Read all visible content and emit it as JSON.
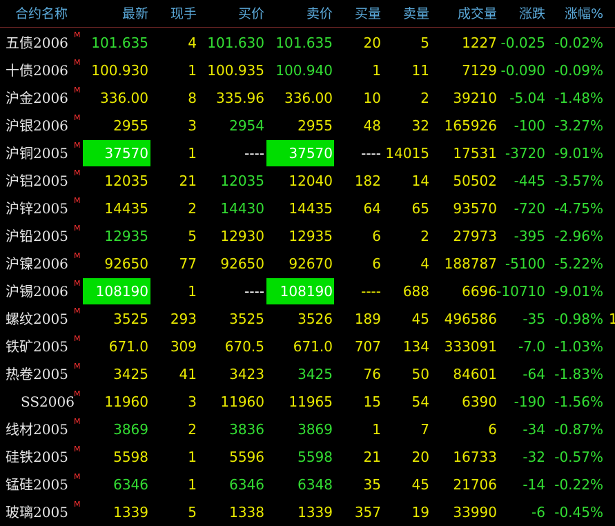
{
  "headers": [
    "合约名称",
    "最新",
    "现手",
    "买价",
    "卖价",
    "买量",
    "卖量",
    "成交量",
    "涨跌",
    "涨幅%"
  ],
  "marker": "M",
  "colors": {
    "header": "#5aa8d8",
    "yellow": "#e8e800",
    "green": "#33dd33",
    "highlight": "#00dd00",
    "marker": "#ff3333"
  },
  "rows": [
    {
      "name": "五债2006",
      "last": "101.635",
      "vol": "4",
      "bid": "101.630",
      "ask": "101.635",
      "bq": "20",
      "aq": "5",
      "tot": "1227",
      "chg": "-0.025",
      "pct": "-0.02%"
    },
    {
      "name": "十债2006",
      "last": "100.930",
      "vol": "1",
      "bid": "100.935",
      "ask": "100.940",
      "bq": "1",
      "aq": "11",
      "tot": "7129",
      "chg": "-0.090",
      "pct": "-0.09%"
    },
    {
      "name": "沪金2006",
      "last": "336.00",
      "vol": "8",
      "bid": "335.96",
      "ask": "336.00",
      "bq": "10",
      "aq": "2",
      "tot": "39210",
      "chg": "-5.04",
      "pct": "-1.48%"
    },
    {
      "name": "沪银2006",
      "last": "2955",
      "vol": "3",
      "bid": "2954",
      "ask": "2955",
      "bq": "48",
      "aq": "32",
      "tot": "165926",
      "chg": "-100",
      "pct": "-3.27%"
    },
    {
      "name": "沪铜2005",
      "last": "37570",
      "vol": "1",
      "bid": "----",
      "ask": "37570",
      "bq": "----",
      "aq": "14015",
      "tot": "17531",
      "chg": "-3720",
      "pct": "-9.01%"
    },
    {
      "name": "沪铝2005",
      "last": "12035",
      "vol": "21",
      "bid": "12035",
      "ask": "12040",
      "bq": "182",
      "aq": "14",
      "tot": "50502",
      "chg": "-445",
      "pct": "-3.57%"
    },
    {
      "name": "沪锌2005",
      "last": "14435",
      "vol": "2",
      "bid": "14430",
      "ask": "14435",
      "bq": "64",
      "aq": "65",
      "tot": "93570",
      "chg": "-720",
      "pct": "-4.75%"
    },
    {
      "name": "沪铅2005",
      "last": "12935",
      "vol": "5",
      "bid": "12930",
      "ask": "12935",
      "bq": "6",
      "aq": "2",
      "tot": "27973",
      "chg": "-395",
      "pct": "-2.96%"
    },
    {
      "name": "沪镍2006",
      "last": "92650",
      "vol": "77",
      "bid": "92650",
      "ask": "92670",
      "bq": "6",
      "aq": "4",
      "tot": "188787",
      "chg": "-5100",
      "pct": "-5.22%"
    },
    {
      "name": "沪锡2006",
      "last": "108190",
      "vol": "1",
      "bid": "----",
      "ask": "108190",
      "bq": "----",
      "aq": "688",
      "tot": "6696",
      "chg": "-10710",
      "pct": "-9.01%"
    },
    {
      "name": "螺纹2005",
      "last": "3525",
      "vol": "293",
      "bid": "3525",
      "ask": "3526",
      "bq": "189",
      "aq": "45",
      "tot": "496586",
      "chg": "-35",
      "pct": "-0.98%",
      "extra": "1"
    },
    {
      "name": "铁矿2005",
      "last": "671.0",
      "vol": "309",
      "bid": "670.5",
      "ask": "671.0",
      "bq": "707",
      "aq": "134",
      "tot": "333091",
      "chg": "-7.0",
      "pct": "-1.03%"
    },
    {
      "name": "热卷2005",
      "last": "3425",
      "vol": "41",
      "bid": "3423",
      "ask": "3425",
      "bq": "76",
      "aq": "50",
      "tot": "84601",
      "chg": "-64",
      "pct": "-1.83%"
    },
    {
      "name": "SS2006",
      "last": "11960",
      "vol": "3",
      "bid": "11960",
      "ask": "11965",
      "bq": "15",
      "aq": "54",
      "tot": "6390",
      "chg": "-190",
      "pct": "-1.56%"
    },
    {
      "name": "线材2005",
      "last": "3869",
      "vol": "2",
      "bid": "3836",
      "ask": "3869",
      "bq": "1",
      "aq": "7",
      "tot": "6",
      "chg": "-34",
      "pct": "-0.87%"
    },
    {
      "name": "硅铁2005",
      "last": "5598",
      "vol": "1",
      "bid": "5596",
      "ask": "5598",
      "bq": "21",
      "aq": "20",
      "tot": "16733",
      "chg": "-32",
      "pct": "-0.57%"
    },
    {
      "name": "锰硅2005",
      "last": "6346",
      "vol": "1",
      "bid": "6346",
      "ask": "6348",
      "bq": "35",
      "aq": "45",
      "tot": "21706",
      "chg": "-14",
      "pct": "-0.22%"
    },
    {
      "name": "玻璃2005",
      "last": "1339",
      "vol": "5",
      "bid": "1338",
      "ask": "1339",
      "bq": "357",
      "aq": "19",
      "tot": "33990",
      "chg": "-6",
      "pct": "-0.45%"
    }
  ]
}
